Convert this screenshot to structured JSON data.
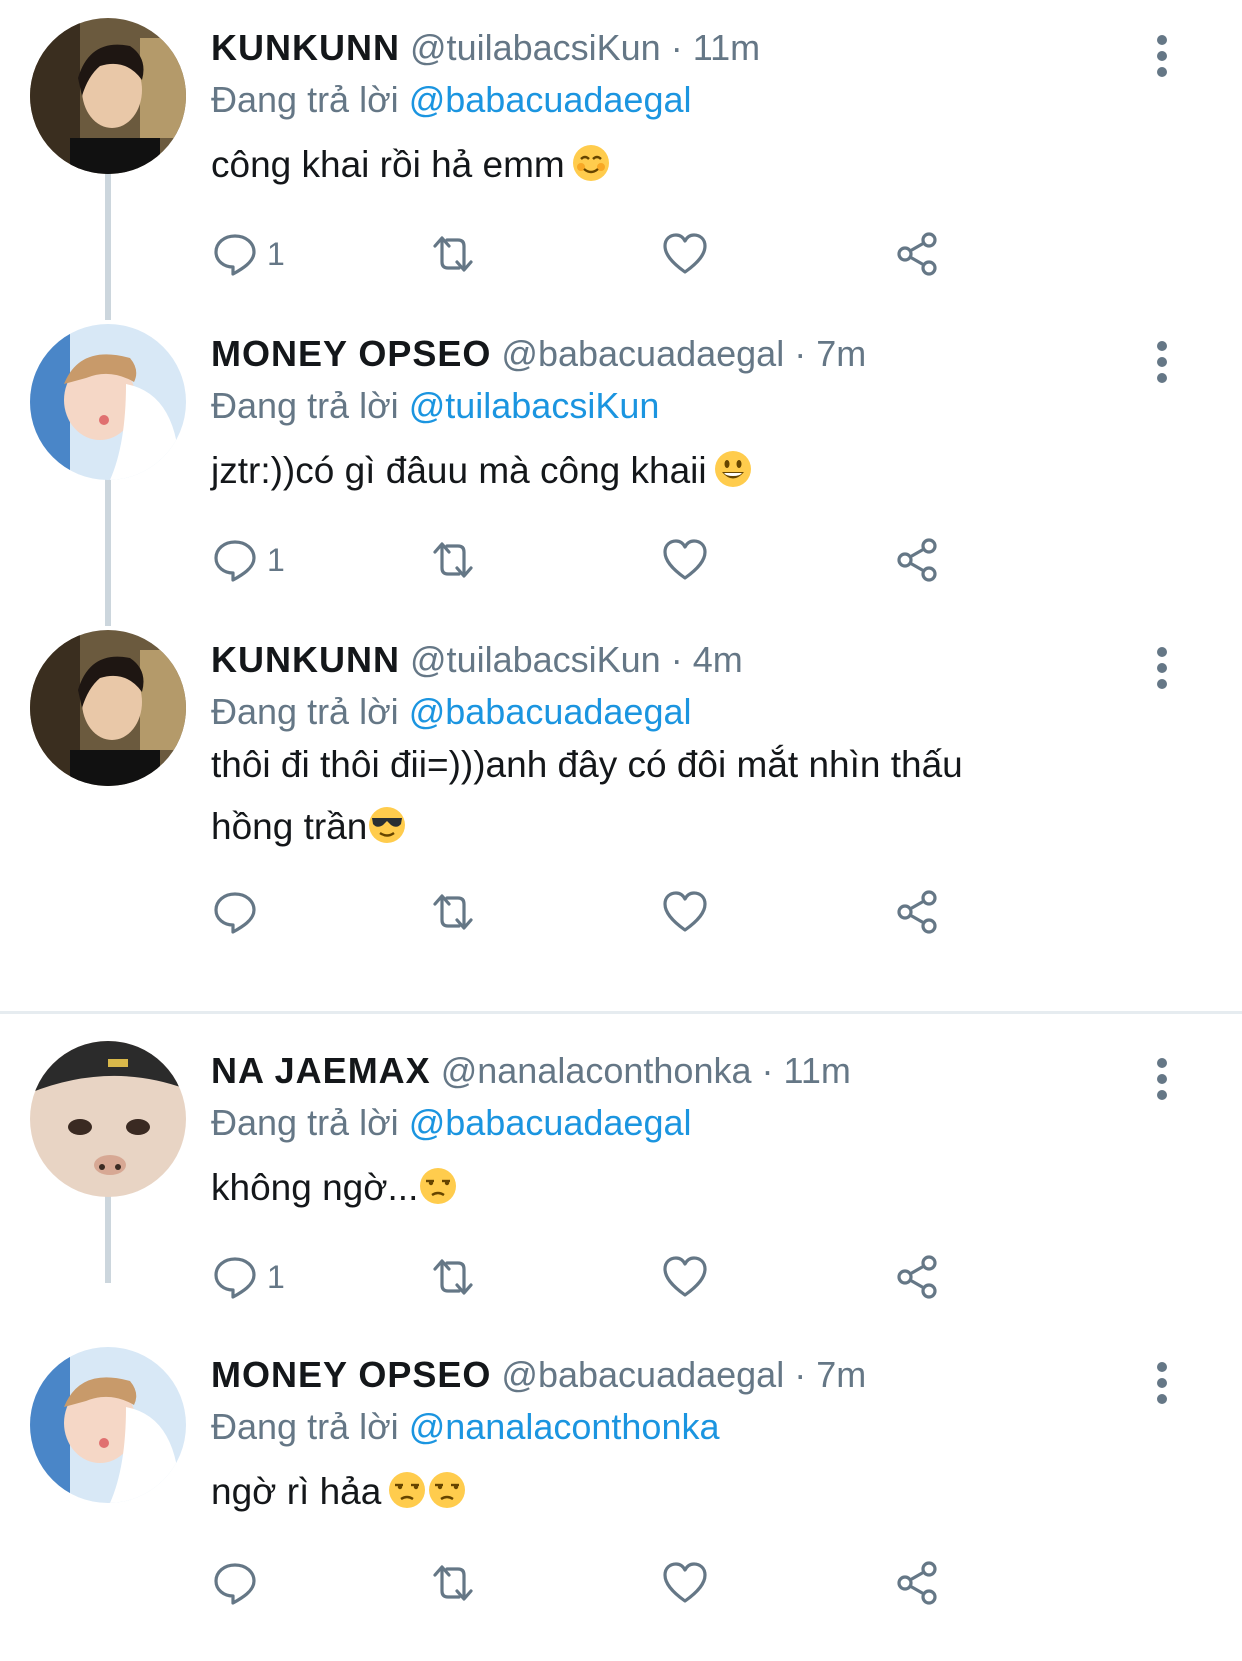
{
  "colors": {
    "name": "#14171a",
    "meta": "#657786",
    "mention": "#1b95e0",
    "thread_line": "#ccd6dd",
    "divider": "#e6ecf0"
  },
  "tweets": [
    {
      "name": "KUNKUNN",
      "handle": "@tuilabacsiKun",
      "sep": "·",
      "time": "11m",
      "reply_prefix": "Đang trả lời",
      "reply_to": "@babacuadaegal",
      "text_lines": [
        "công khai rồi hả emm"
      ],
      "emoji": [
        "smiling-blush-emoji"
      ],
      "reply_count": "1",
      "avatar": "kunkunn-avatar"
    },
    {
      "name": "MONEY OPSEO",
      "handle": "@babacuadaegal",
      "sep": "·",
      "time": "7m",
      "reply_prefix": "Đang trả lời",
      "reply_to": "@tuilabacsiKun",
      "text_lines": [
        "jztr:))có gì đâuu mà công khaii"
      ],
      "emoji": [
        "grinning-emoji"
      ],
      "reply_count": "1",
      "avatar": "money-opseo-avatar"
    },
    {
      "name": "KUNKUNN",
      "handle": "@tuilabacsiKun",
      "sep": "·",
      "time": "4m",
      "reply_prefix": "Đang trả lời",
      "reply_to": "@babacuadaegal",
      "text_lines": [
        "thôi đi thôi đii=)))anh đây có đôi mắt nhìn thấu",
        "hồng trần"
      ],
      "emoji": [
        "sunglasses-emoji"
      ],
      "reply_count": "",
      "avatar": "kunkunn-avatar"
    },
    {
      "name": "NA JAEMAX",
      "handle": "@nanalaconthonka",
      "sep": "·",
      "time": "11m",
      "reply_prefix": "Đang trả lời",
      "reply_to": "@babacuadaegal",
      "text_lines": [
        "không ngờ..."
      ],
      "emoji": [
        "unamused-emoji"
      ],
      "reply_count": "1",
      "avatar": "na-jaemax-avatar"
    },
    {
      "name": "MONEY OPSEO",
      "handle": "@babacuadaegal",
      "sep": "·",
      "time": "7m",
      "reply_prefix": "Đang trả lời",
      "reply_to": "@nanalaconthonka",
      "text_lines": [
        "ngờ rì hảa"
      ],
      "emoji": [
        "unamused-emoji",
        "unamused-emoji"
      ],
      "reply_count": "",
      "avatar": "money-opseo-avatar"
    }
  ]
}
